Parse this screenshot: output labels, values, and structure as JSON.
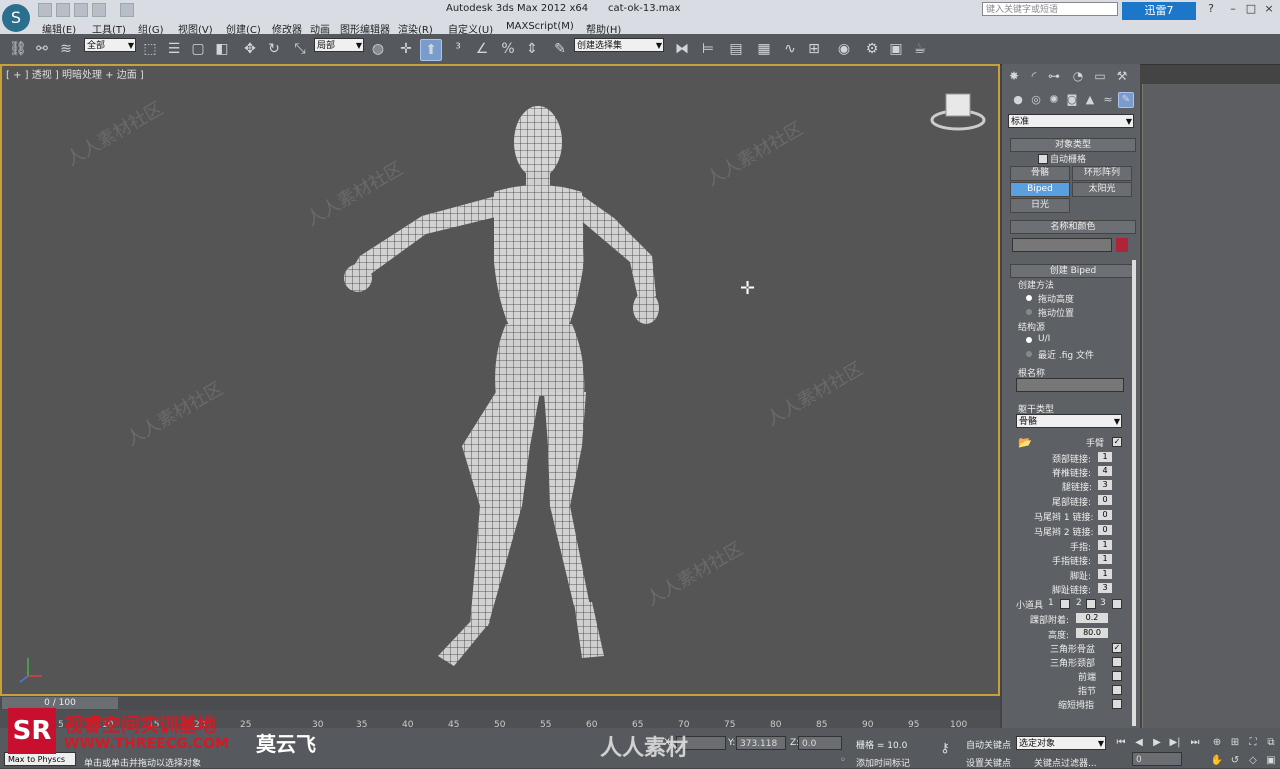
{
  "titlebar": {
    "app_title": "Autodesk 3ds Max  2012 x64",
    "file_name": "cat-ok-13.max",
    "search_placeholder": "键入关键字或短语",
    "xunlei_label": "迅雷7",
    "help_icon": "?"
  },
  "menu": [
    "编辑(E)",
    "工具(T)",
    "组(G)",
    "视图(V)",
    "创建(C)",
    "修改器",
    "动画",
    "图形编辑器",
    "渲染(R)",
    "自定义(U)",
    "MAXScript(M)",
    "帮助(H)"
  ],
  "toolbar": {
    "selection_filter": "全部",
    "coord_system": "局部",
    "named_selection": "创建选择集"
  },
  "viewport": {
    "label": "[ + ] 透视 ] 明暗处理 + 边面 ]",
    "watermark_text": "人人素材社区"
  },
  "command_panel": {
    "category_dropdown": "标准",
    "object_type": {
      "header": "对象类型",
      "autogrid_label": "自动栅格",
      "buttons": [
        "骨骼",
        "环形阵列",
        "Biped",
        "太阳光",
        "日光"
      ],
      "selected": "Biped"
    },
    "name_color": {
      "header": "名称和颜色",
      "name_value": "",
      "color": "#b0243a"
    },
    "create_biped": {
      "header": "创建 Biped",
      "method_group": "创建方法",
      "method_options": [
        "拖动高度",
        "拖动位置"
      ],
      "structure_group": "结构源",
      "structure_options": [
        "U/I",
        "最近 .fig 文件"
      ],
      "root_name_label": "根名称",
      "root_name_value": "",
      "body_type_label": "躯干类型",
      "body_type_value": "骨骼",
      "params": [
        {
          "label": "手臂",
          "value": "✓"
        },
        {
          "label": "颈部链接:",
          "value": "1"
        },
        {
          "label": "脊椎链接:",
          "value": "4"
        },
        {
          "label": "腿链接:",
          "value": "3"
        },
        {
          "label": "尾部链接:",
          "value": "0"
        },
        {
          "label": "马尾辫 1 链接:",
          "value": "0"
        },
        {
          "label": "马尾辫 2 链接:",
          "value": "0"
        },
        {
          "label": "手指:",
          "value": "1"
        },
        {
          "label": "手指链接:",
          "value": "1"
        },
        {
          "label": "脚趾:",
          "value": "1"
        },
        {
          "label": "脚趾链接:",
          "value": "3"
        }
      ],
      "props_label": "小道具",
      "props_numbers": [
        "1",
        "2",
        "3"
      ],
      "ankle_label": "踝部附着:",
      "ankle_value": "0.2",
      "height_label": "高度:",
      "height_value": "80.0",
      "checkboxes": [
        {
          "label": "三角形骨盆",
          "checked": true
        },
        {
          "label": "三角形颈部",
          "checked": false
        },
        {
          "label": "前端",
          "checked": false
        },
        {
          "label": "指节",
          "checked": false
        },
        {
          "label": "缩短拇指",
          "checked": false
        }
      ]
    }
  },
  "timeline": {
    "frame_readout": "0 / 100",
    "ticks": [
      "5",
      "10",
      "15",
      "20",
      "25",
      "30",
      "35",
      "40",
      "45",
      "50",
      "55",
      "60",
      "65",
      "70",
      "75",
      "80",
      "85",
      "90",
      "95",
      "100"
    ]
  },
  "statusbar": {
    "maxscript_label": "Max to Physcs",
    "prompt": "单击或单击并拖动以选择对象",
    "x_label": "X:",
    "x_value": "",
    "y_label": "Y:",
    "y_value": "373.118",
    "z_label": "Z:",
    "z_value": "0.0",
    "grid_label": "栅格 = 10.0",
    "add_time_tag": "添加时间标记",
    "auto_key": "自动关键点",
    "set_key": "设置关键点",
    "key_mode_dropdown": "选定对象",
    "key_filters": "关键点过滤器...",
    "frame_field": "0"
  },
  "overlay": {
    "sr_logo": "SR",
    "brand_line1": "视睿空间实训基地",
    "brand_line2": "WWW.THREECG.COM",
    "author": "莫云飞",
    "site_brand": "人人素材"
  }
}
